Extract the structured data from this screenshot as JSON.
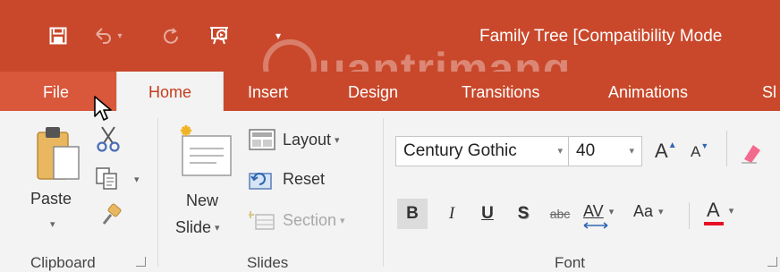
{
  "window": {
    "title": "Family Tree [Compatibility Mode",
    "watermark": "uantrimang",
    "accent_color": "#c9482b"
  },
  "qat": {
    "save_icon": "save-icon",
    "undo_icon": "undo-icon",
    "redo_icon": "redo-icon",
    "present_icon": "start-from-beginning-icon",
    "customize_icon": "customize-qat-icon"
  },
  "tabs": [
    {
      "label": "File"
    },
    {
      "label": "Home"
    },
    {
      "label": "Insert"
    },
    {
      "label": "Design"
    },
    {
      "label": "Transitions"
    },
    {
      "label": "Animations"
    },
    {
      "label": "Sl"
    }
  ],
  "clipboard": {
    "paste_label": "Paste",
    "group_label": "Clipboard"
  },
  "slides": {
    "new_slide_line1": "New",
    "new_slide_line2": "Slide",
    "layout_label": "Layout",
    "reset_label": "Reset",
    "section_label": "Section",
    "group_label": "Slides"
  },
  "font": {
    "font_name": "Century Gothic",
    "font_size": "40",
    "bold": "B",
    "italic": "I",
    "underline": "U",
    "shadow": "S",
    "strike": "abc",
    "spacing": "AV",
    "case": "Aa",
    "color_a": "A",
    "grow": "A",
    "shrink": "A",
    "group_label": "Font",
    "font_color": "#e81123"
  }
}
